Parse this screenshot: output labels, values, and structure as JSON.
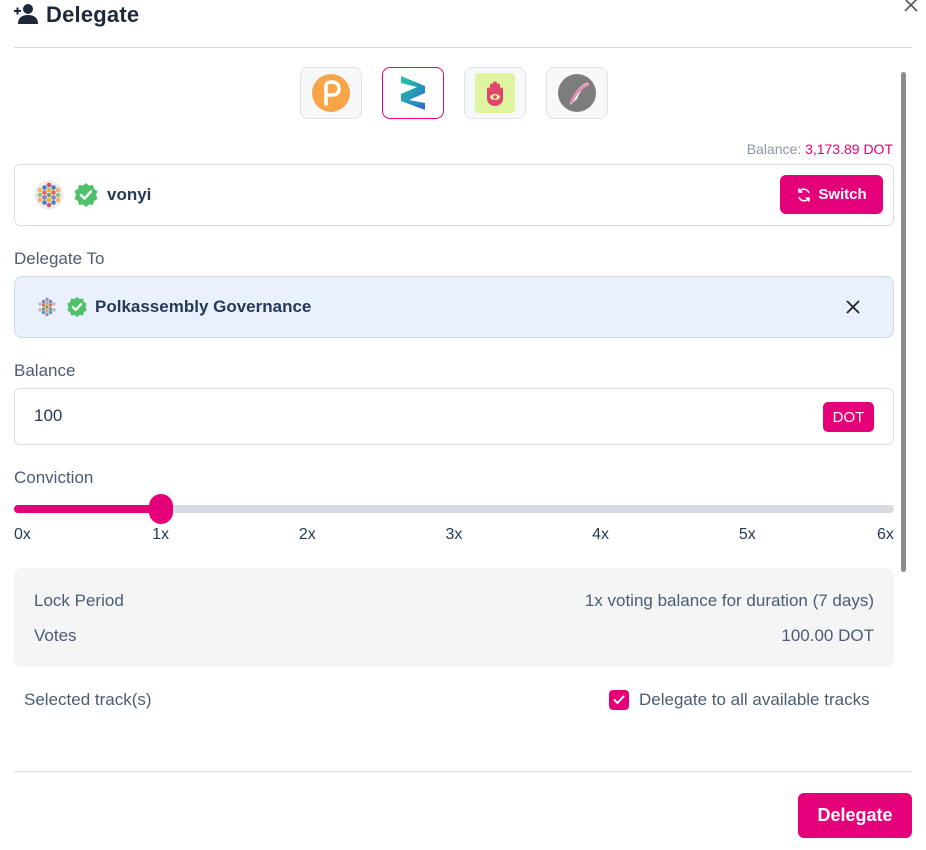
{
  "header": {
    "title": "Delegate"
  },
  "wallets": [
    {
      "name": "Polkadot",
      "icon": "polkadot-wallet-icon",
      "selected": false,
      "color": "#f7a548"
    },
    {
      "name": "SubWallet",
      "icon": "subwallet-icon",
      "selected": true,
      "color": "#2f9bd6"
    },
    {
      "name": "Talisman",
      "icon": "talisman-icon",
      "selected": false,
      "color": "#e0466d"
    },
    {
      "name": "PolkaGate",
      "icon": "polkagate-icon",
      "selected": false,
      "color": "#e58bb9"
    }
  ],
  "balance": {
    "label": "Balance:",
    "value": "3,173.89 DOT"
  },
  "account": {
    "name": "vonyi",
    "switch_label": "Switch"
  },
  "delegate_to": {
    "label": "Delegate To",
    "name": "Polkassembly Governance"
  },
  "amount": {
    "label": "Balance",
    "value": "100",
    "unit": "DOT"
  },
  "conviction": {
    "label": "Conviction",
    "ticks": [
      "0x",
      "1x",
      "2x",
      "3x",
      "4x",
      "5x",
      "6x"
    ],
    "selected_index": 1
  },
  "info": {
    "lock_period_label": "Lock Period",
    "lock_period_value": "1x voting balance for duration (7 days)",
    "votes_label": "Votes",
    "votes_value": "100.00 DOT"
  },
  "tracks": {
    "label": "Selected track(s)",
    "all_tracks_label": "Delegate to all available tracks",
    "all_tracks_checked": true
  },
  "footer": {
    "delegate_label": "Delegate"
  },
  "colors": {
    "accent": "#e5007a",
    "text": "#243a57",
    "verified": "#4fc168"
  }
}
